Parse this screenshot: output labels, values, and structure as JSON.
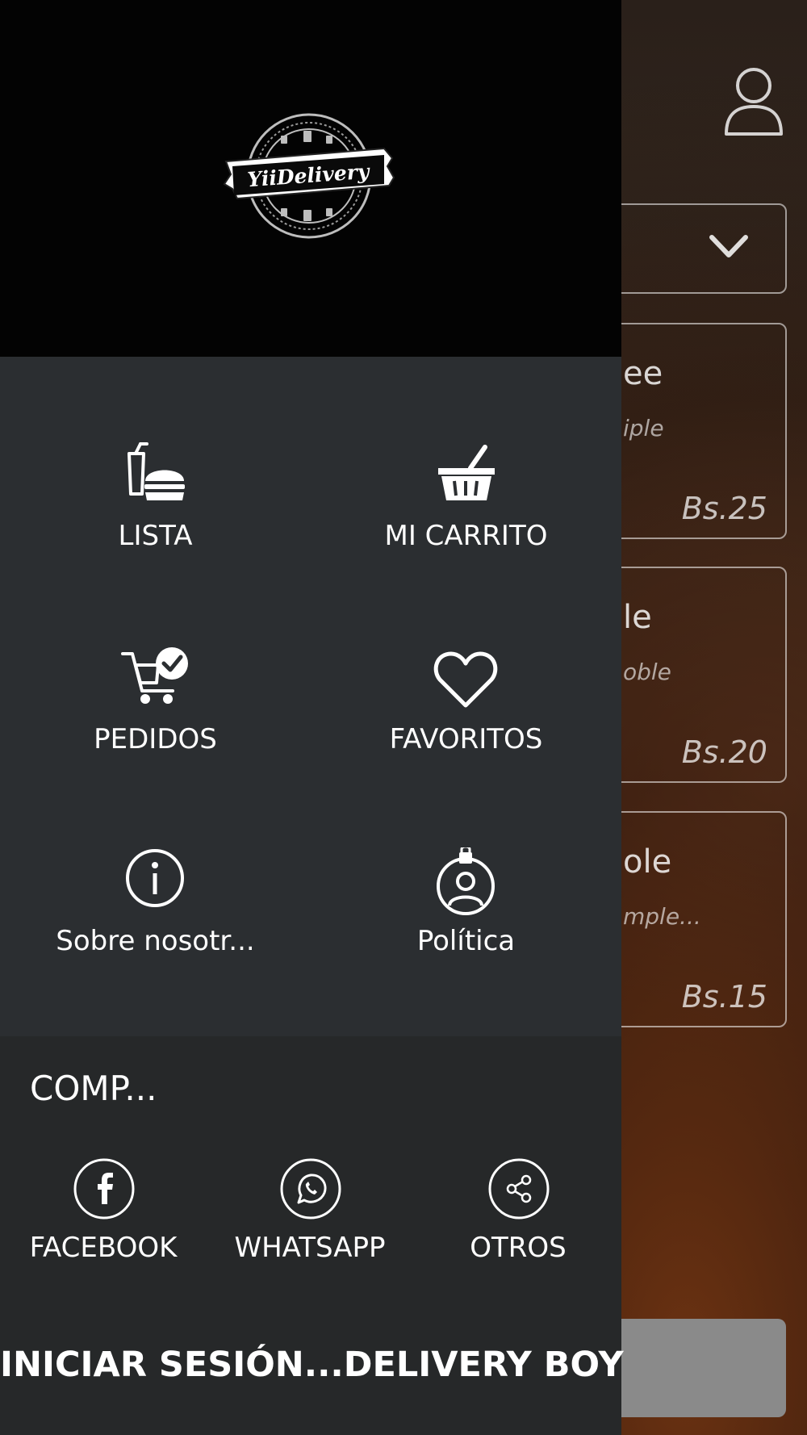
{
  "background": {
    "cards": [
      {
        "title": "ee",
        "desc": "iple",
        "price": "Bs.25"
      },
      {
        "title": "le",
        "desc": "oble",
        "price": "Bs.20"
      },
      {
        "title": "ole",
        "desc": "mple...",
        "price": "Bs.15"
      }
    ],
    "icons": {
      "user": "user-icon",
      "dropdown": "chevron-down-icon"
    }
  },
  "drawer": {
    "logo_text": "YiiDelivery",
    "menu": [
      {
        "label": "LISTA",
        "icon": "food-menu-icon"
      },
      {
        "label": "MI CARRITO",
        "icon": "basket-icon"
      },
      {
        "label": "PEDIDOS",
        "icon": "cart-check-icon"
      },
      {
        "label": "FAVORITOS",
        "icon": "heart-icon"
      },
      {
        "label": "Sobre nosotr...",
        "icon": "info-icon"
      },
      {
        "label": "Política",
        "icon": "privacy-icon"
      }
    ],
    "share": {
      "title": "COMP...",
      "items": [
        {
          "label": "FACEBOOK",
          "icon": "facebook-icon"
        },
        {
          "label": "WHATSAPP",
          "icon": "whatsapp-icon"
        },
        {
          "label": "OTROS",
          "icon": "share-icon"
        }
      ]
    },
    "login_label": "INICIAR SESIÓN...DELIVERY BOY"
  },
  "colors": {
    "drawer_bg": "#2b2e31",
    "header_bg": "#030303",
    "share_bg": "#262829",
    "text": "#ffffff"
  }
}
